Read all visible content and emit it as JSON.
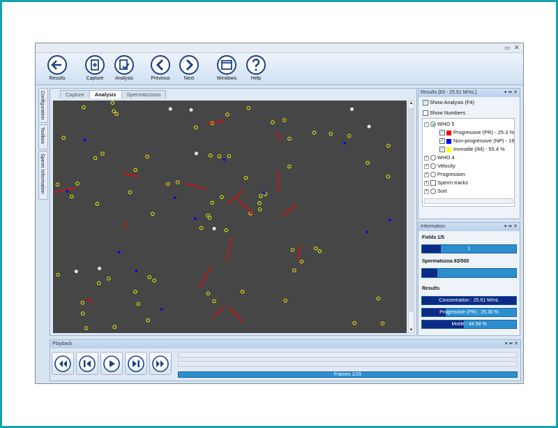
{
  "window": {
    "min_glyph": "▭",
    "close_glyph": "✕"
  },
  "toolbar": {
    "buttons": [
      {
        "label": "Results",
        "icon": "arrow-left-icon"
      },
      {
        "label": "Capture",
        "icon": "add-document-icon"
      },
      {
        "label": "Analysis",
        "icon": "analysis-icon"
      },
      {
        "label": "Previous",
        "icon": "chevron-left-icon"
      },
      {
        "label": "Next",
        "icon": "chevron-right-icon"
      },
      {
        "label": "Windows",
        "icon": "window-icon"
      },
      {
        "label": "Help",
        "icon": "question-icon"
      }
    ]
  },
  "side_tabs": [
    "Configuration",
    "Toolbox",
    "Sperm Information"
  ],
  "doc_tabs": [
    {
      "label": "Capture",
      "active": false
    },
    {
      "label": "Analysis",
      "active": true
    },
    {
      "label": "Spermatozoon",
      "active": false
    }
  ],
  "results_panel": {
    "title": "Results [83 - 25.61 M/mL]",
    "controls": "▾ ⇹ ✕",
    "show_analysis": {
      "label": "Show Analysis (F4)",
      "checked": true
    },
    "show_numbers": {
      "label": "Show Numbers",
      "checked": false
    },
    "tree": {
      "who5": "WHO 5",
      "progressive": "Progressive (PR) - 25.3 %",
      "nonprogressive": "Non-progressive (NP) - 19",
      "immotile": "Immotile (IM) - 55.4 %",
      "who4": "WHO 4",
      "velocity": "Velocity",
      "progression": "Progression",
      "sperm_tracks": "Sperm tracks",
      "sort": "Sort"
    },
    "colors": {
      "progressive": "#ff0000",
      "nonprogressive": "#0000ff",
      "immotile": "#ffff00"
    }
  },
  "info_panel": {
    "title": "Information",
    "controls": "▾ ⇹ ✕",
    "fields_label": "Fields 1/5",
    "fields_bar_text": "1",
    "fields_progress": 0.2,
    "spermatozoa_label": "Spermatozoa 83/500",
    "spermatozoa_progress": 0.166,
    "results_label": "Results",
    "concentration": "Concentration : 25.61 M/mL",
    "concentration_progress": 1.0,
    "progressive_pr": "Progressive (PR) : 25.30 %",
    "progressive_progress": 0.253,
    "motile": "Motile : 44.58 %",
    "motile_progress": 0.4458
  },
  "playback": {
    "title": "Playback",
    "controls": "▾ ⇹ ✕",
    "frames_label": "Frames 1/25"
  }
}
